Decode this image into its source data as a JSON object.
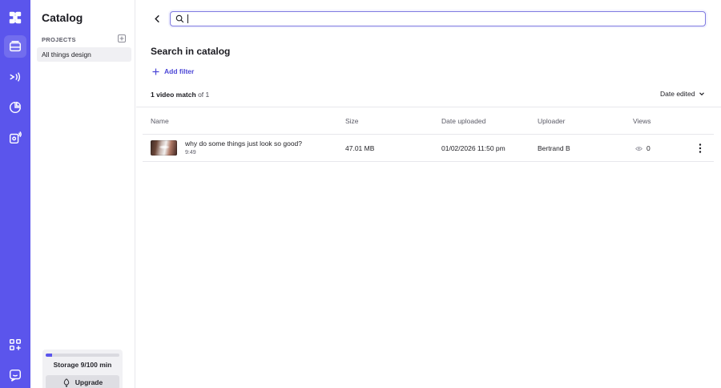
{
  "sidebar": {
    "title": "Catalog",
    "projects_label": "PROJECTS",
    "items": [
      {
        "label": "All things design"
      }
    ],
    "storage": {
      "label": "Storage 9/100 min",
      "used_fraction": 0.09
    },
    "upgrade_label": "Upgrade"
  },
  "search": {
    "value": "",
    "placeholder": ""
  },
  "main": {
    "title": "Search in catalog",
    "add_filter_label": "Add filter",
    "match_count": "1 video match",
    "match_total": "of 1",
    "sort_label": "Date edited"
  },
  "table": {
    "columns": [
      "Name",
      "Size",
      "Date uploaded",
      "Uploader",
      "Views"
    ],
    "rows": [
      {
        "title": "why do some things just look so good?",
        "duration": "9:49",
        "size": "47.01 MB",
        "date_uploaded": "01/02/2026 11:50 pm",
        "uploader": "Bertrand B",
        "views": "0"
      }
    ]
  },
  "colors": {
    "accent": "#5b55ec",
    "link": "#4c47d6"
  },
  "icons": {
    "rail": [
      "app-logo-icon",
      "library-icon",
      "broadcast-icon",
      "analytics-icon",
      "live-icon",
      "integrations-icon",
      "chat-icon"
    ]
  }
}
